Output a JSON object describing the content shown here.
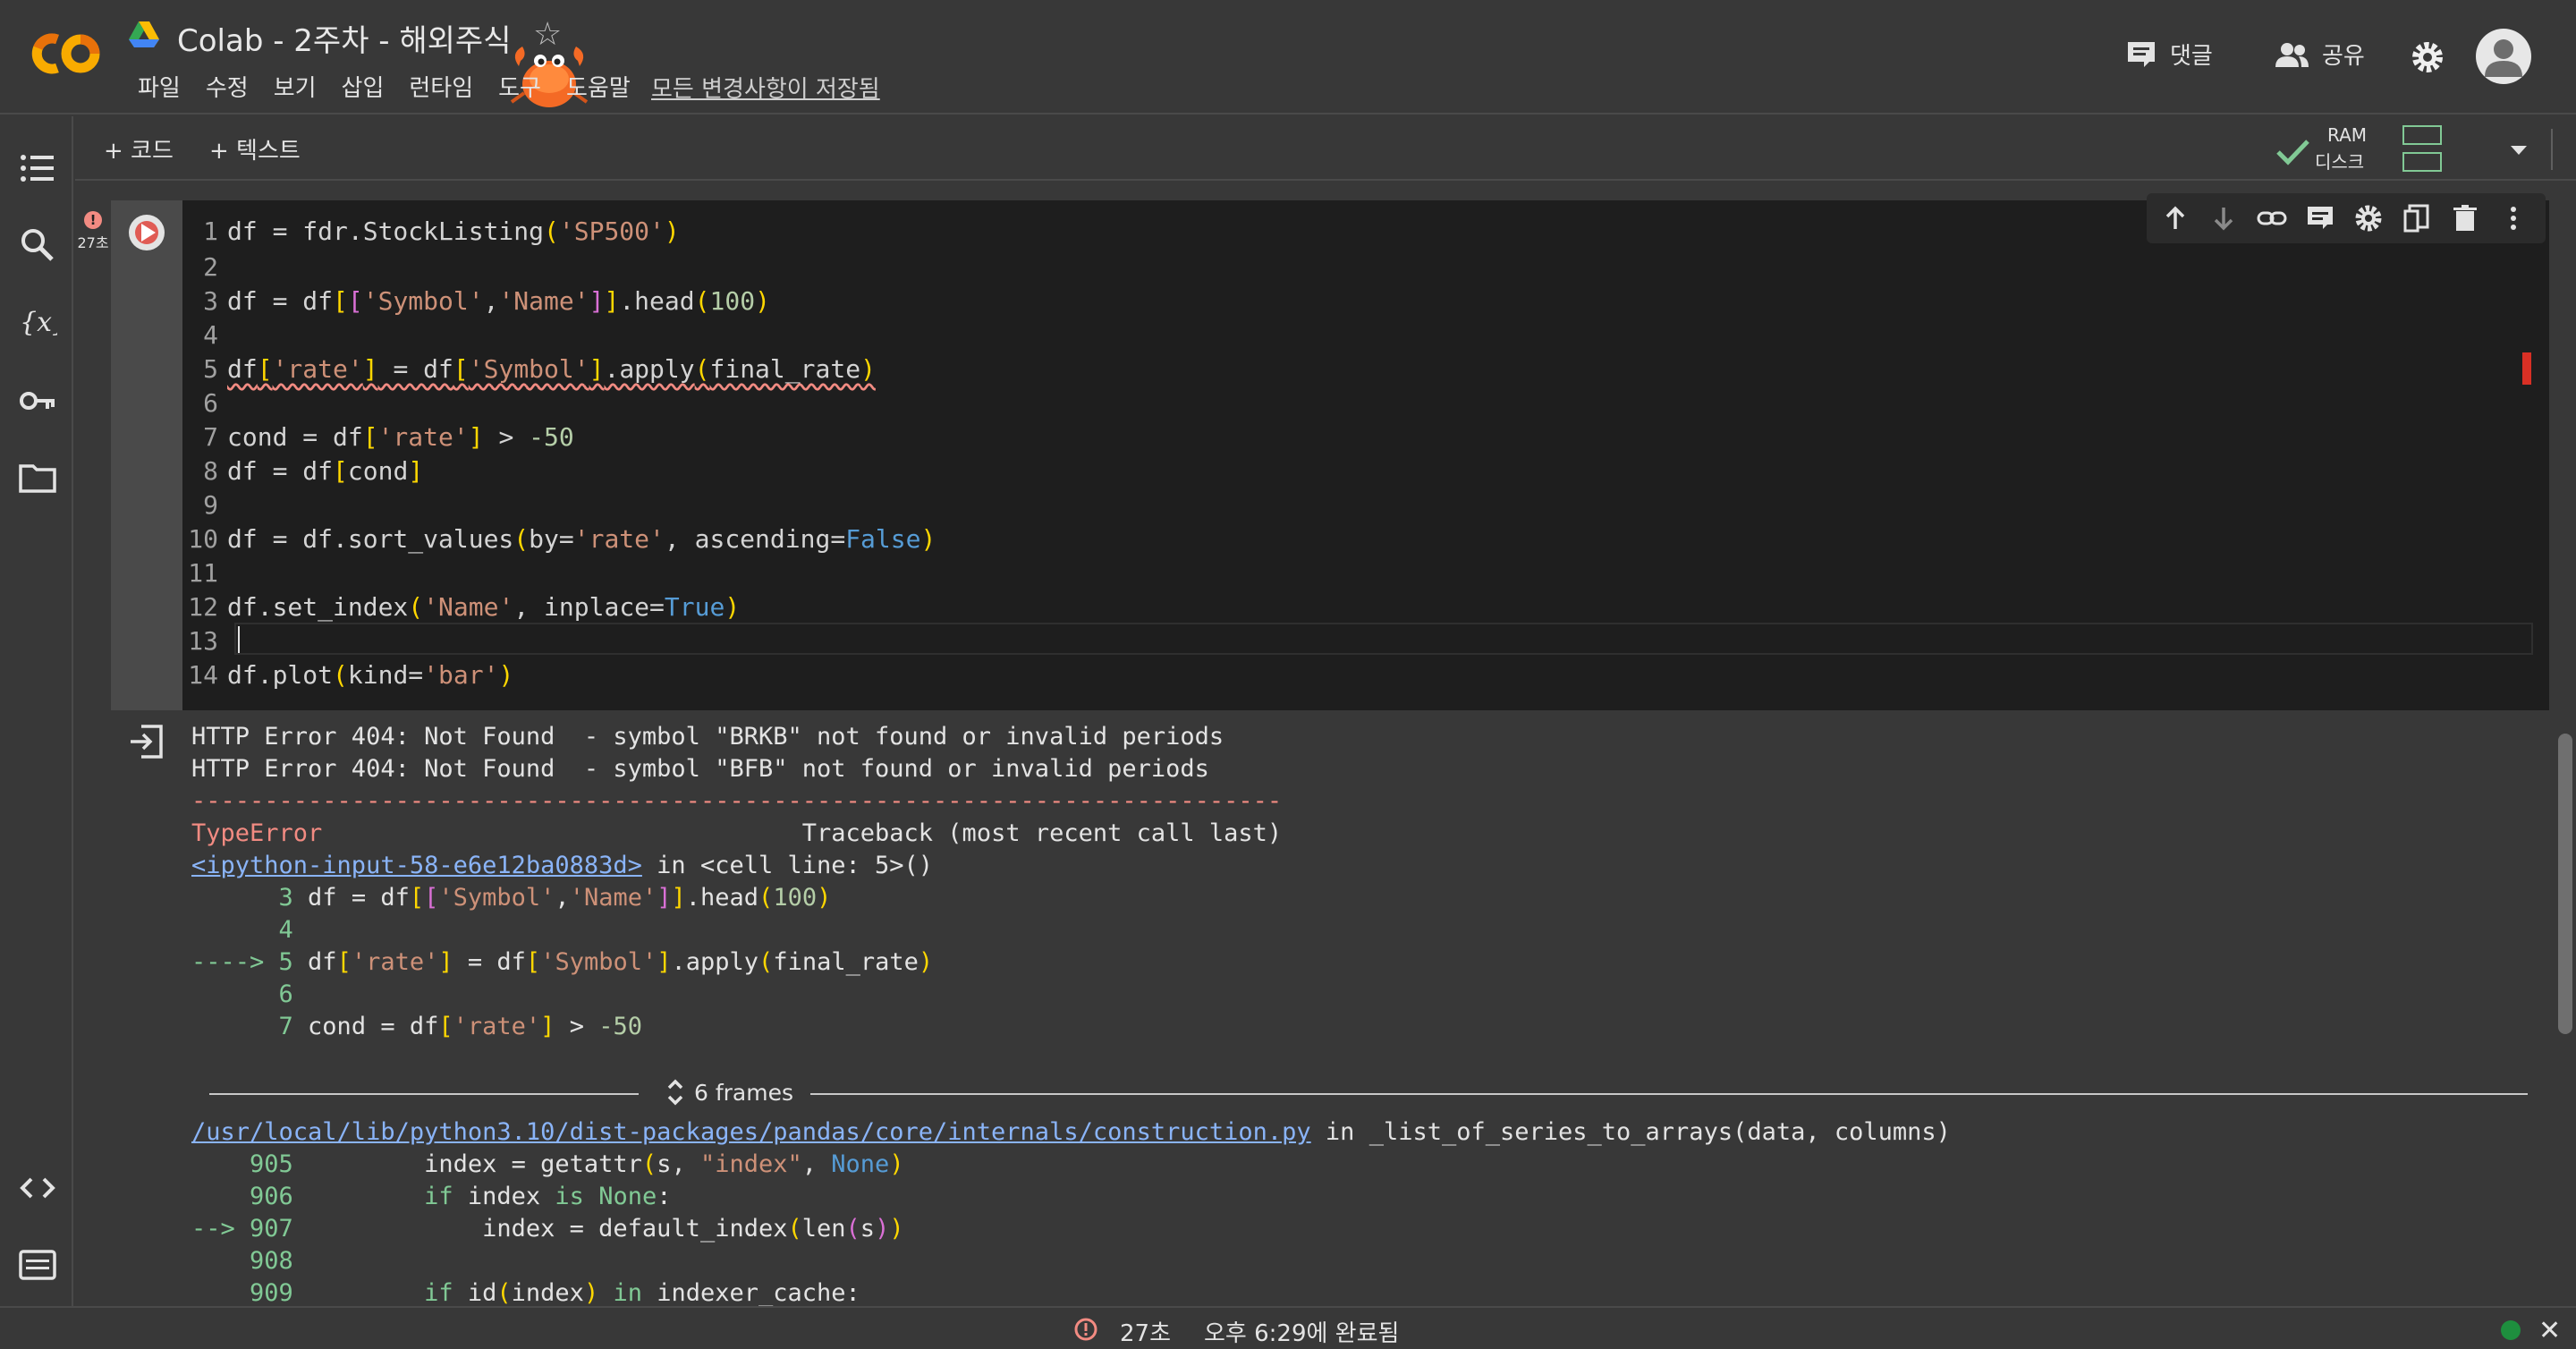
{
  "header": {
    "title": "Colab - 2주차 - 해외주식",
    "menu": [
      "파일",
      "수정",
      "보기",
      "삽입",
      "런타임",
      "도구",
      "도움말"
    ],
    "saved_status": "모든 변경사항이 저장됨",
    "comment_label": "댓글",
    "share_label": "공유"
  },
  "toolbar": {
    "add_code": "+ 코드",
    "add_text": "+ 텍스트",
    "ram_label": "RAM",
    "disk_label": "디스크"
  },
  "cell": {
    "exec_time": "27초",
    "lines": [
      "1",
      "2",
      "3",
      "4",
      "5",
      "6",
      "7",
      "8",
      "9",
      "10",
      "11",
      "12",
      "13",
      "14"
    ]
  },
  "output": {
    "err1": "HTTP Error 404: Not Found  - symbol \"BRKB\" not found or invalid periods",
    "err2": "HTTP Error 404: Not Found  - symbol \"BFB\" not found or invalid periods",
    "dashes": "---------------------------------------------------------------------------",
    "type_error": "TypeError",
    "traceback": "Traceback (most recent call last)",
    "input_link": "<ipython-input-58-e6e12ba0883d>",
    "input_where": " in <cell line: 5>()",
    "frames_label": "6 frames",
    "path_link": "/usr/local/lib/python3.10/dist-packages/pandas/core/internals/construction.py",
    "path_where": " in _list_of_series_to_arrays(data, columns)"
  },
  "status": {
    "time": "27초",
    "done": "오후 6:29에 완료됨"
  },
  "colors": {
    "background": "#383838",
    "editor_bg": "#1e1e1e",
    "error_red": "#f28b82",
    "link_blue": "#8ab4f8",
    "ok_green": "#81c995"
  }
}
